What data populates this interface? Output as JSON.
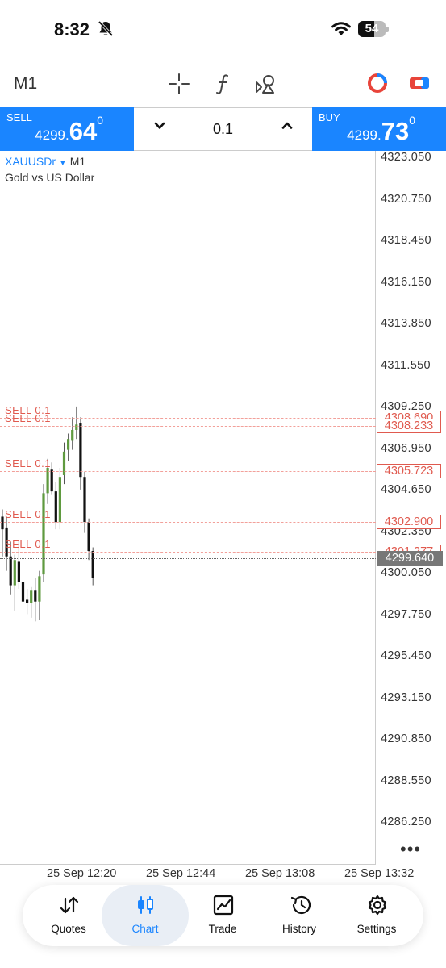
{
  "status_bar": {
    "time": "8:32",
    "battery": "54"
  },
  "toolbar": {
    "timeframe": "M1"
  },
  "trade_panel": {
    "sell": {
      "label": "SELL",
      "price_small": "4299.",
      "price_big": "64",
      "price_sup": "0"
    },
    "buy": {
      "label": "BUY",
      "price_small": "4299.",
      "price_big": "73",
      "price_sup": "0"
    },
    "lot": "0.1"
  },
  "chart": {
    "symbol": "XAUUSDr",
    "timeframe": "M1",
    "description": "Gold vs US Dollar",
    "y_ticks": [
      "4323.050",
      "4320.750",
      "4318.450",
      "4316.150",
      "4313.850",
      "4311.550",
      "4309.250",
      "4306.950",
      "4304.650",
      "4302.350",
      "4300.050",
      "4297.750",
      "4295.450",
      "4293.150",
      "4290.850",
      "4288.550",
      "4286.250"
    ],
    "x_ticks": [
      "25 Sep 12:20",
      "25 Sep 12:44",
      "25 Sep 13:08",
      "25 Sep 13:32"
    ],
    "orders": [
      {
        "label": "SELL 0.1",
        "price": "4308.690"
      },
      {
        "label": "SELL 0.1",
        "price": "4308.233"
      },
      {
        "label": "SELL 0.1",
        "price": "4305.723"
      },
      {
        "label": "SELL 0.1",
        "price": "4302.900"
      },
      {
        "label": "SELL 0.1",
        "price": "4301.277"
      }
    ],
    "bid_price": "4299.640",
    "more": "•••",
    "up_color": "#5f9a3f",
    "down_color": "#111111",
    "order_color": "#e05a4f",
    "candles": [
      {
        "o": 4303.2,
        "h": 4303.6,
        "l": 4301.0,
        "c": 4302.5
      },
      {
        "o": 4302.6,
        "h": 4303.2,
        "l": 4300.2,
        "c": 4301.0
      },
      {
        "o": 4301.0,
        "h": 4301.8,
        "l": 4298.9,
        "c": 4299.4
      },
      {
        "o": 4299.4,
        "h": 4301.1,
        "l": 4298.0,
        "c": 4300.8
      },
      {
        "o": 4300.7,
        "h": 4301.9,
        "l": 4299.2,
        "c": 4299.6
      },
      {
        "o": 4299.6,
        "h": 4300.3,
        "l": 4298.1,
        "c": 4298.5
      },
      {
        "o": 4298.6,
        "h": 4299.2,
        "l": 4297.8,
        "c": 4298.4
      },
      {
        "o": 4298.4,
        "h": 4299.3,
        "l": 4297.6,
        "c": 4299.1
      },
      {
        "o": 4299.1,
        "h": 4299.8,
        "l": 4297.4,
        "c": 4298.5
      },
      {
        "o": 4298.5,
        "h": 4300.2,
        "l": 4297.5,
        "c": 4299.9
      },
      {
        "o": 4300.0,
        "h": 4305.0,
        "l": 4299.6,
        "c": 4304.5
      },
      {
        "o": 4304.5,
        "h": 4306.4,
        "l": 4303.9,
        "c": 4305.9
      },
      {
        "o": 4305.8,
        "h": 4306.2,
        "l": 4304.4,
        "c": 4304.6
      },
      {
        "o": 4304.6,
        "h": 4305.1,
        "l": 4302.5,
        "c": 4302.9
      },
      {
        "o": 4302.9,
        "h": 4305.9,
        "l": 4302.5,
        "c": 4305.4
      },
      {
        "o": 4305.5,
        "h": 4307.3,
        "l": 4305.0,
        "c": 4306.8
      },
      {
        "o": 4306.9,
        "h": 4307.8,
        "l": 4306.3,
        "c": 4307.5
      },
      {
        "o": 4307.4,
        "h": 4308.7,
        "l": 4306.9,
        "c": 4308.0
      },
      {
        "o": 4308.0,
        "h": 4309.3,
        "l": 4307.5,
        "c": 4308.3
      },
      {
        "o": 4308.4,
        "h": 4308.7,
        "l": 4304.7,
        "c": 4305.4
      },
      {
        "o": 4305.4,
        "h": 4305.7,
        "l": 4302.3,
        "c": 4302.9
      },
      {
        "o": 4302.9,
        "h": 4303.1,
        "l": 4300.8,
        "c": 4301.3
      },
      {
        "o": 4301.3,
        "h": 4301.5,
        "l": 4299.4,
        "c": 4299.8
      }
    ]
  },
  "nav": {
    "quotes": "Quotes",
    "chart": "Chart",
    "trade": "Trade",
    "history": "History",
    "settings": "Settings"
  }
}
